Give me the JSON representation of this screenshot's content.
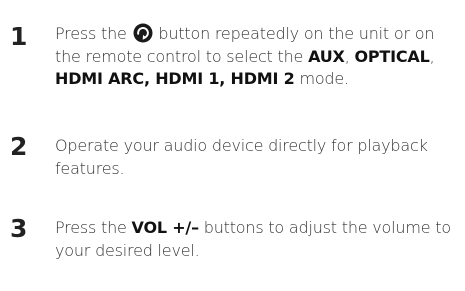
{
  "steps": [
    {
      "number": "1",
      "pre": "Press the ",
      "icon": "source-icon",
      "post": " button repeatedly on the unit or on the remote control to select the ",
      "modes": [
        {
          "label": "AUX",
          "sep": ", "
        },
        {
          "label": "OPTICAL",
          "sep": ", "
        },
        {
          "label": "HDMI ARC, HDMI 1, HDMI 2",
          "sep": ""
        }
      ],
      "tail": " mode."
    },
    {
      "number": "2",
      "text": "Operate your audio device directly for playback features."
    },
    {
      "number": "3",
      "pre": "Press the ",
      "bold": "VOL +/–",
      "post": " buttons to adjust the volume to your desired level."
    }
  ]
}
